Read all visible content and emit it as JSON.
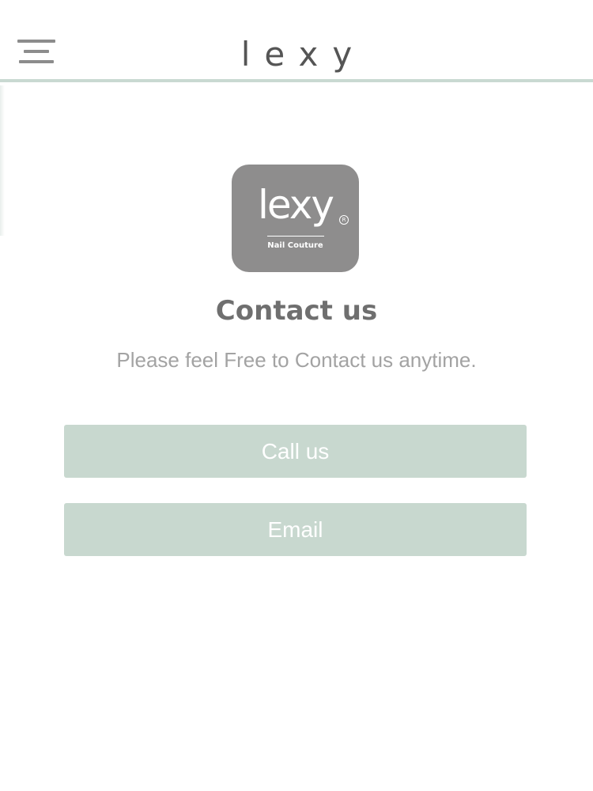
{
  "header": {
    "title": "lexy",
    "menu_icon": "hamburger-menu-icon"
  },
  "logo": {
    "wordmark": "lexy",
    "registered_mark": "R",
    "tagline": "Nail Couture",
    "tile_color": "#8e8d8d"
  },
  "main": {
    "title": "Contact us",
    "subtitle": "Please feel Free to Contact us anytime.",
    "buttons": {
      "call_label": "Call us",
      "email_label": "Email"
    }
  },
  "colors": {
    "accent": "#c8d8cf",
    "header_rule": "#c9d9d2",
    "text_dark": "#555555",
    "text_muted": "#a3a3a3"
  }
}
